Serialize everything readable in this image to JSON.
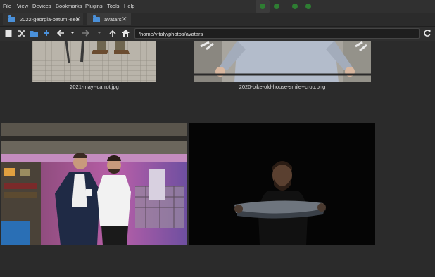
{
  "menu": [
    "File",
    "View",
    "Devices",
    "Bookmarks",
    "Plugins",
    "Tools",
    "Help"
  ],
  "tabs": [
    {
      "label": "2022-georgia-batumi-sea",
      "active": false
    },
    {
      "label": "avatars",
      "active": true
    }
  ],
  "toolbar": {
    "path_value": "/home/vitaly/photos/avatars"
  },
  "files": [
    {
      "name": "2021-may--carrot.jpg"
    },
    {
      "name": "2020-bike-old-house-smile--crop.png"
    },
    {
      "name": ""
    },
    {
      "name": ""
    }
  ],
  "colors": {
    "accent": "#4a90d9",
    "indicator": "#2e7d32",
    "background": "#2b2b2b"
  }
}
